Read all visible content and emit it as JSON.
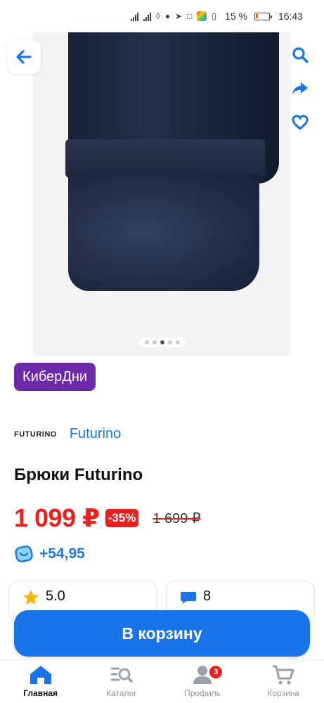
{
  "status_bar": {
    "battery": "15 %",
    "time": "16:43"
  },
  "gallery": {
    "dots_count": 5,
    "active_dot": 2
  },
  "promo_badge": "КиберДни",
  "brand": {
    "logo_text": "FUTURINO",
    "name": "Futurino"
  },
  "product": {
    "title": "Брюки Futurino"
  },
  "price": {
    "current": "1 099 ₽",
    "discount": "-35%",
    "old": "1 699 ₽"
  },
  "bonus": {
    "value": "+54,95"
  },
  "cards": [
    {
      "icon": "star-icon",
      "text": "5.0"
    },
    {
      "icon": "comment-icon",
      "text": "8"
    }
  ],
  "cart_button": "В корзину",
  "nav": {
    "items": [
      {
        "label": "Главная",
        "icon": "home-icon",
        "active": true
      },
      {
        "label": "Каталог",
        "icon": "catalog-icon",
        "active": false
      },
      {
        "label": "Профиль",
        "icon": "profile-icon",
        "active": false,
        "badge": "3"
      },
      {
        "label": "Корзина",
        "icon": "cart-icon",
        "active": false
      }
    ]
  },
  "colors": {
    "accent_blue": "#1a73e8",
    "price_red": "#e8201f",
    "promo_purple": "#6d2aa8",
    "link_blue": "#1c7ad9"
  }
}
